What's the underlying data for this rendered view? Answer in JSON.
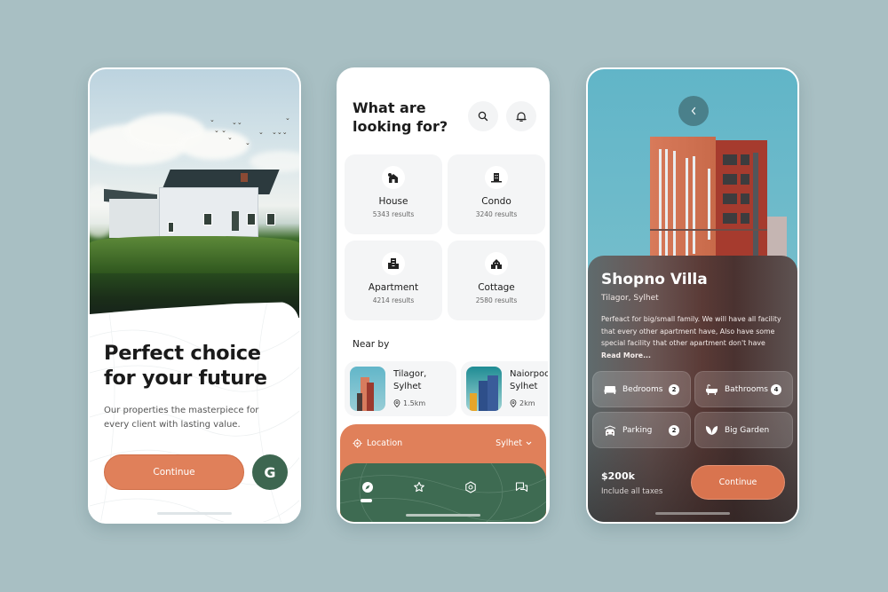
{
  "colors": {
    "background": "#a8bfc3",
    "accent_orange": "#e0805a",
    "accent_green": "#3e6b52"
  },
  "onboarding": {
    "title_line1": "Perfect choice",
    "title_line2": "for your future",
    "subtitle": "Our properties the masterpiece for every client with lasting value.",
    "continue_label": "Continue",
    "google_label": "G",
    "hero_image": "white-farmhouse-in-grass-field-with-birds"
  },
  "search": {
    "title_line1": "What are",
    "title_line2": "looking for?",
    "search_icon": "search-icon",
    "bell_icon": "bell-icon",
    "categories": [
      {
        "label": "House",
        "count": "5343 results",
        "icon": "house-icon"
      },
      {
        "label": "Condo",
        "count": "3240 results",
        "icon": "condo-icon"
      },
      {
        "label": "Apartment",
        "count": "4214 results",
        "icon": "apartment-icon"
      },
      {
        "label": "Cottage",
        "count": "2580 results",
        "icon": "cottage-icon"
      }
    ],
    "nearby_heading": "Near by",
    "nearby": [
      {
        "name": "Tilagor,\nSylhet",
        "distance": "1.5km"
      },
      {
        "name": "Naiorpool,\nSylhet",
        "distance": "2km"
      }
    ],
    "location_label": "Location",
    "location_value": "Sylhet",
    "tabs": [
      {
        "name": "explore",
        "icon": "compass-icon",
        "active": true
      },
      {
        "name": "favorites",
        "icon": "star-icon",
        "active": false
      },
      {
        "name": "settings",
        "icon": "gear-icon",
        "active": false
      },
      {
        "name": "messages",
        "icon": "chat-icon",
        "active": false
      }
    ]
  },
  "detail": {
    "back_icon": "chevron-left-icon",
    "title": "Shopno Villa",
    "location": "Tilagor, Sylhet",
    "description": "Perfeact for big/small family. We will have all facility that every other apartment have, Also have some special facility that other apartment don't have",
    "read_more": "Read More...",
    "features": [
      {
        "label": "Bedrooms",
        "count": "2",
        "icon": "bed-icon"
      },
      {
        "label": "Bathrooms",
        "count": "4",
        "icon": "bathtub-icon"
      },
      {
        "label": "Parking",
        "count": "2",
        "icon": "car-icon"
      },
      {
        "label": "Big Garden",
        "count": null,
        "icon": "leaf-icon"
      }
    ],
    "price": "$200k",
    "price_note": "Include all taxes",
    "continue_label": "Continue"
  }
}
